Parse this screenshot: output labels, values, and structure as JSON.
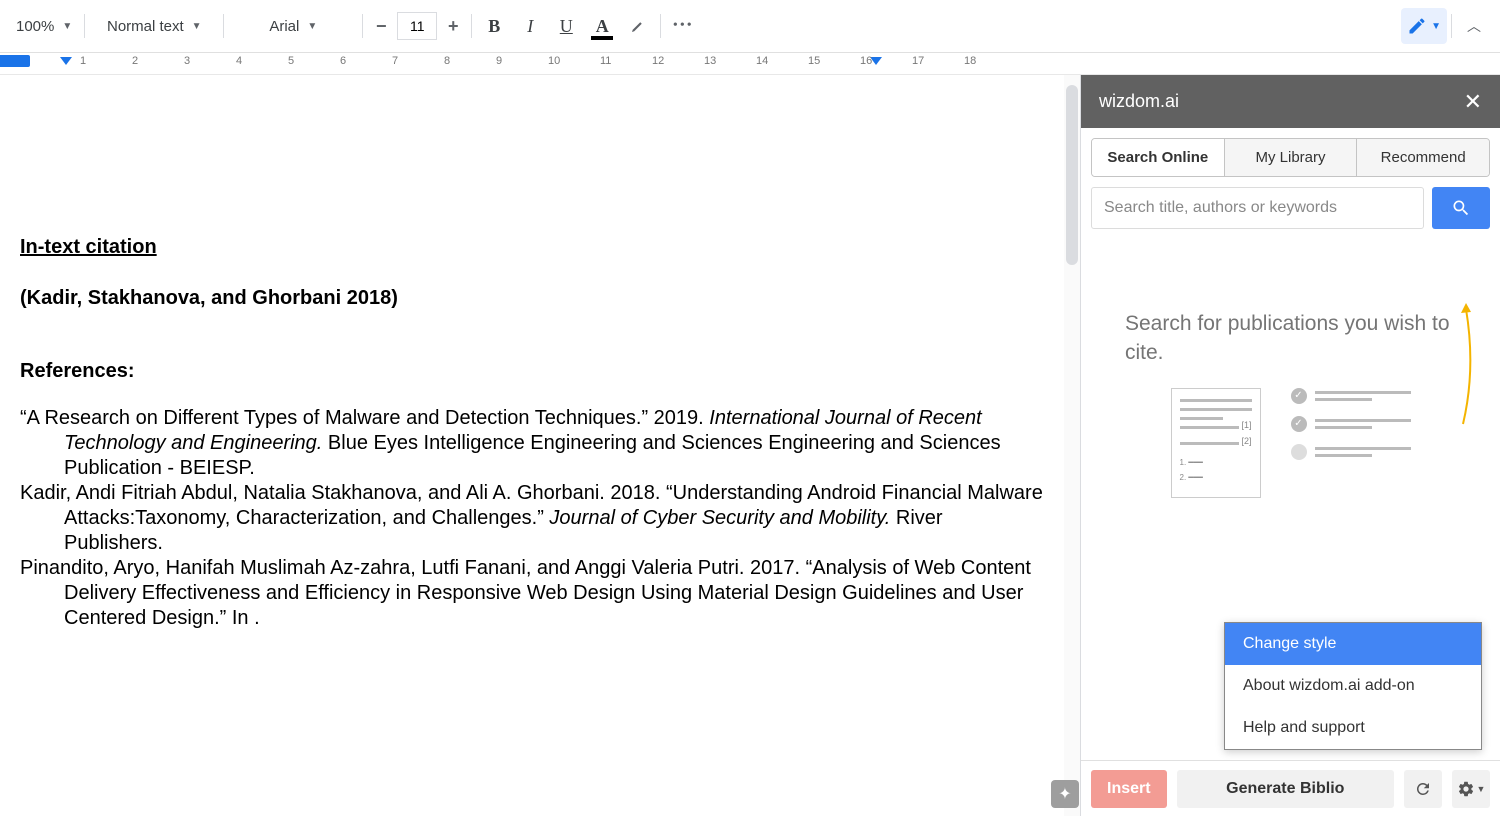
{
  "toolbar": {
    "zoom": "100%",
    "style": "Normal text",
    "font": "Arial",
    "font_size": "11",
    "bold": "B",
    "italic": "I",
    "underline": "U",
    "text_color": "A",
    "more": "•••"
  },
  "ruler": {
    "marks": [
      "1",
      "2",
      "3",
      "4",
      "5",
      "6",
      "7",
      "8",
      "9",
      "10",
      "11",
      "12",
      "13",
      "14",
      "15",
      "16",
      "17",
      "18"
    ]
  },
  "document": {
    "heading": "In-text citation",
    "citation": "(Kadir, Stakhanova, and Ghorbani 2018)",
    "refs_label": "References:",
    "ref1_a": "“A Research on Different Types of Malware and Detection Techniques.” 2019. ",
    "ref1_b": "International Journal of Recent Technology and Engineering.",
    "ref1_c": " Blue Eyes Intelligence Engineering and Sciences Engineering and Sciences Publication - BEIESP.",
    "ref2_a": "Kadir, Andi Fitriah Abdul, Natalia Stakhanova, and Ali A. Ghorbani. 2018. “Understanding Android Financial Malware Attacks:Taxonomy, Characterization, and Challenges.” ",
    "ref2_b": "Journal of Cyber Security and Mobility.",
    "ref2_c": " River Publishers.",
    "ref3": "Pinandito, Aryo, Hanifah Muslimah Az-zahra, Lutfi Fanani, and Anggi Valeria Putri. 2017. “Analysis of Web Content Delivery Effectiveness and Efficiency in Responsive Web Design Using Material Design Guidelines and User Centered Design.” In ."
  },
  "sidepanel": {
    "title": "wizdom.ai",
    "tabs": {
      "search": "Search Online",
      "library": "My Library",
      "recommend": "Recommend"
    },
    "search_placeholder": "Search title, authors or keywords",
    "hint": "Search for publications you wish to cite.",
    "popup": {
      "change_style": "Change style",
      "about": "About wizdom.ai add-on",
      "help": "Help and support"
    },
    "footer": {
      "insert": "Insert",
      "generate": "Generate Biblio"
    }
  }
}
